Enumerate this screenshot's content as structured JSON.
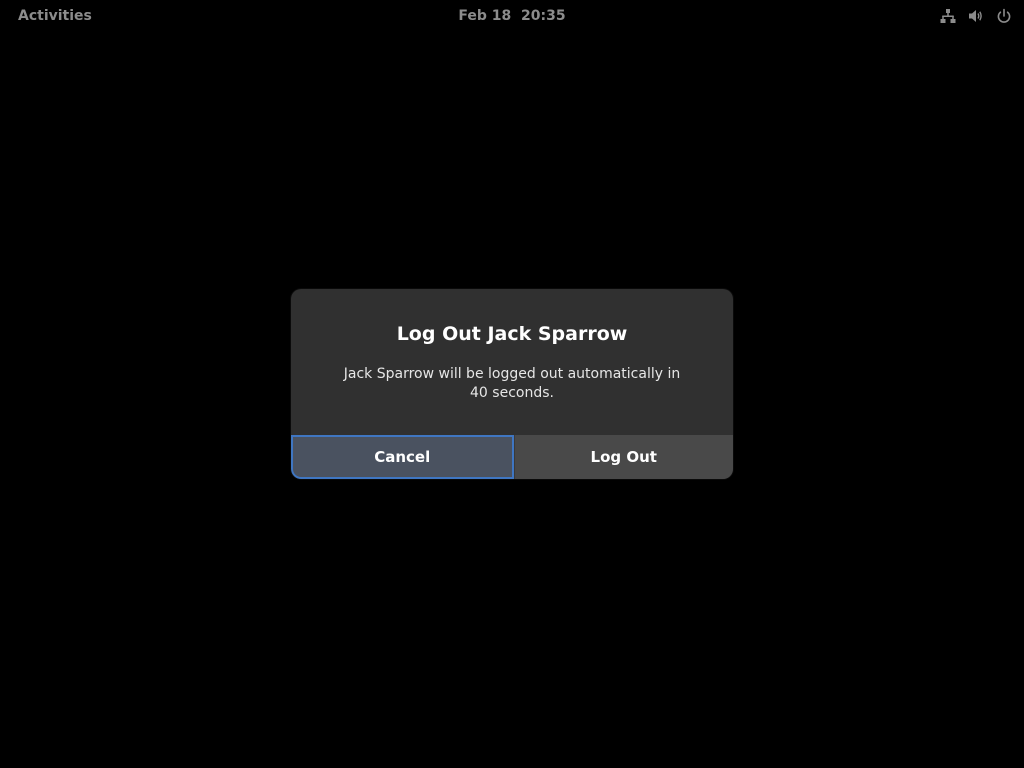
{
  "topbar": {
    "activities_label": "Activities",
    "clock": "Feb 18  20:35",
    "tray_icons": [
      "network-wired-icon",
      "volume-icon",
      "power-icon"
    ]
  },
  "dialog": {
    "title": "Log Out Jack Sparrow",
    "message": "Jack Sparrow will be logged out automatically in 40 seconds.",
    "buttons": {
      "cancel_label": "Cancel",
      "logout_label": "Log Out"
    }
  },
  "colors": {
    "background": "#000000",
    "topbar_text": "#8c8c8c",
    "dialog_bg": "#303030",
    "cancel_bg": "#4a5260",
    "focus_ring": "#3f76c2",
    "logout_bg": "#494949"
  }
}
